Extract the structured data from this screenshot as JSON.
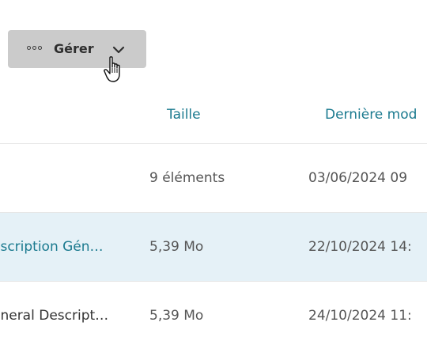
{
  "toolbar": {
    "manage_label": "Gérer",
    "manage_icon": "more-dots-icon",
    "dropdown_icon": "chevron-down-icon"
  },
  "table": {
    "columns": {
      "size": "Taille",
      "modified": "Dernière mod"
    },
    "rows": [
      {
        "name": "",
        "size": "9 éléments",
        "modified": "03/06/2024 09",
        "selected": false
      },
      {
        "name": "escription Gén…",
        "size": "5,39 Mo",
        "modified": "22/10/2024 14:",
        "selected": true
      },
      {
        "name": "eneral Descript…",
        "size": "5,39 Mo",
        "modified": "24/10/2024 11:",
        "selected": false
      }
    ]
  },
  "colors": {
    "accent": "#1b7a8f",
    "selected_row": "#e5f1f7",
    "button_bg": "#cbcbcb"
  }
}
